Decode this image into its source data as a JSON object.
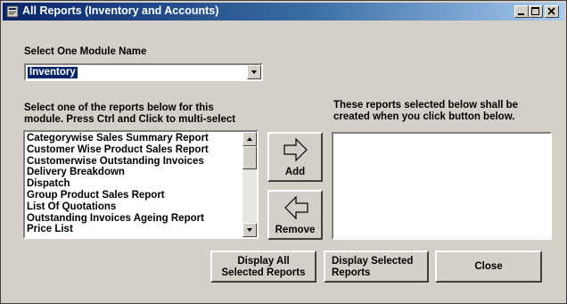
{
  "window": {
    "title": "All Reports (Inventory and Accounts)"
  },
  "labels": {
    "module_label": "Select One Module Name",
    "reports_instruction": "Select one of the reports below for this\nmodule. Press Ctrl and Click to multi-select",
    "selected_instruction": "These reports selected below shall be\ncreated when you click button below."
  },
  "module_combo": {
    "selected": "Inventory"
  },
  "report_list": {
    "items": [
      "Categorywise Sales Summary Report",
      "Customer Wise Product Sales Report",
      "Customerwise Outstanding Invoices",
      "Delivery Breakdown",
      "Dispatch",
      "Group Product Sales Report",
      "List Of Quotations",
      "Outstanding Invoices Ageing Report",
      "Price List"
    ]
  },
  "selected_list": {
    "items": []
  },
  "buttons": {
    "add": "Add",
    "remove": "Remove",
    "display_all": "Display All\nSelected Reports",
    "display_selected": "Display Selected\nReports",
    "close": "Close"
  },
  "icons": {
    "add": "right-arrow-icon",
    "remove": "left-arrow-icon",
    "title": "app-icon"
  }
}
